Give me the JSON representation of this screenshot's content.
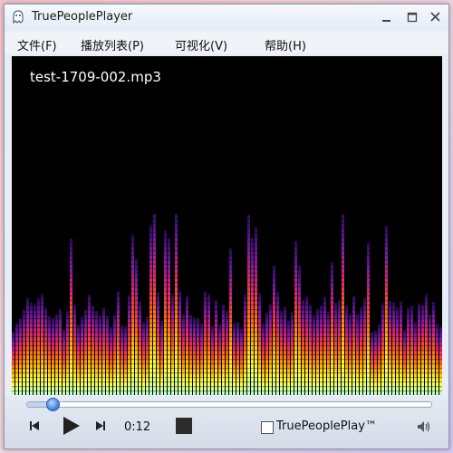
{
  "window": {
    "title": "TruePeoplePlayer"
  },
  "menu": [
    "文件(F)",
    "播放列表(P)",
    "可视化(V)",
    "帮助(H)"
  ],
  "now_playing": {
    "filename": "test-1709-002.mp3"
  },
  "playback": {
    "elapsed": "0:12",
    "progress_fraction": 0.06
  },
  "options": {
    "trueplay_label": "TruePeoplePlay™",
    "trueplay_checked": false
  },
  "icons": {
    "app": "ghost-icon",
    "minimize": "minimize-icon",
    "maximize": "maximize-icon",
    "close": "close-icon",
    "previous": "skip-previous-icon",
    "play": "play-icon",
    "next": "skip-next-icon",
    "stop": "stop-icon",
    "volume": "speaker-icon"
  },
  "colors": {
    "viz_gradient": [
      "#2a0a5a",
      "#7a1aa8",
      "#e0237a",
      "#ff5a1e",
      "#ffb400",
      "#ffff40",
      "#b8ffd0"
    ]
  }
}
